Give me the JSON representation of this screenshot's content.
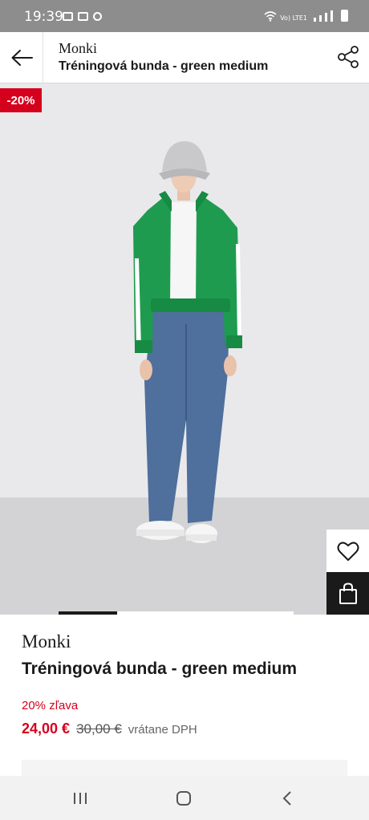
{
  "status_bar": {
    "time": "19:39",
    "lte_label": "Vo) LTE1"
  },
  "header": {
    "brand": "Monki",
    "title": "Tréningová bunda - green medium"
  },
  "image": {
    "discount_badge": "-20%",
    "description": "model wearing green track jacket, white top, blue jeans, grey bucket hat, white sneakers"
  },
  "product": {
    "brand": "Monki",
    "title": "Tréningová bunda - green medium",
    "discount_text": "20% zľava",
    "price": "24,00 €",
    "original_price": "30,00 €",
    "vat_note": "vrátane DPH"
  },
  "colors": {
    "accent_red": "#d5001c",
    "jacket_green": "#1e9b4f",
    "denim": "#4f6f9c"
  },
  "icons": [
    "back-arrow-icon",
    "share-icon",
    "heart-icon",
    "shopping-bag-icon",
    "recent-apps-icon",
    "home-icon",
    "back-icon"
  ],
  "image_carousel": {
    "active_index": 1,
    "total": 4
  }
}
